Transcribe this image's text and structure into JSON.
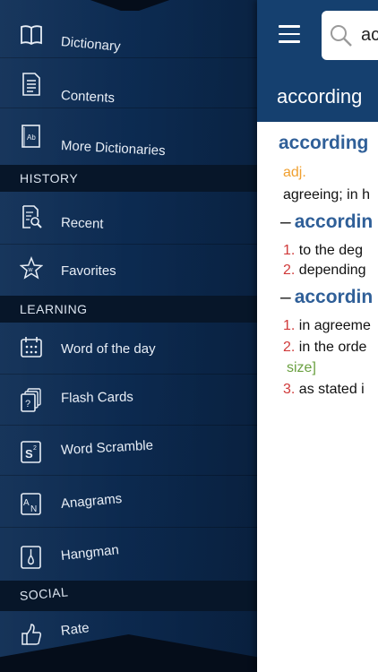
{
  "drawer": {
    "items_top": [
      {
        "label": "Dictionary",
        "icon": "book-icon"
      },
      {
        "label": "Contents",
        "icon": "document-icon"
      },
      {
        "label": "More Dictionaries",
        "icon": "ab-book-icon"
      }
    ],
    "sections": {
      "history": "HISTORY",
      "learning": "LEARNING",
      "social": "SOCIAL"
    },
    "history_items": [
      {
        "label": "Recent",
        "icon": "recent-search-icon"
      },
      {
        "label": "Favorites",
        "icon": "star-w-icon"
      }
    ],
    "learning_items": [
      {
        "label": "Word of the day",
        "icon": "calendar-icon"
      },
      {
        "label": "Flash Cards",
        "icon": "flash-cards-icon"
      },
      {
        "label": "Word Scramble",
        "icon": "scramble-s2-icon"
      },
      {
        "label": "Anagrams",
        "icon": "anagram-an-icon"
      },
      {
        "label": "Hangman",
        "icon": "hangman-icon"
      }
    ],
    "social_items": [
      {
        "label": "Rate",
        "icon": "thumbs-up-icon"
      }
    ]
  },
  "main": {
    "search": {
      "value": "ac"
    },
    "header_word": "according",
    "entry": {
      "headword": "according",
      "pos": "adj.",
      "definition": "agreeing; in h",
      "sub1": {
        "title": "accordin",
        "senses": [
          {
            "num": "1.",
            "text": "to the deg"
          },
          {
            "num": "2.",
            "text": "depending"
          }
        ]
      },
      "sub2": {
        "title": "accordin",
        "senses": [
          {
            "num": "1.",
            "text": "in agreeme"
          },
          {
            "num": "2.",
            "text": "in the orde"
          },
          {
            "num": "3.",
            "text": "as stated i"
          }
        ],
        "note": "size]"
      }
    }
  },
  "colors": {
    "drawer_bg": "#0c2a50",
    "section_bg": "#071629",
    "topbar_bg": "#15406f",
    "headword": "#2f5f98",
    "pos": "#f0a030",
    "sense_number": "#d03a3a",
    "note": "#6aa040"
  }
}
